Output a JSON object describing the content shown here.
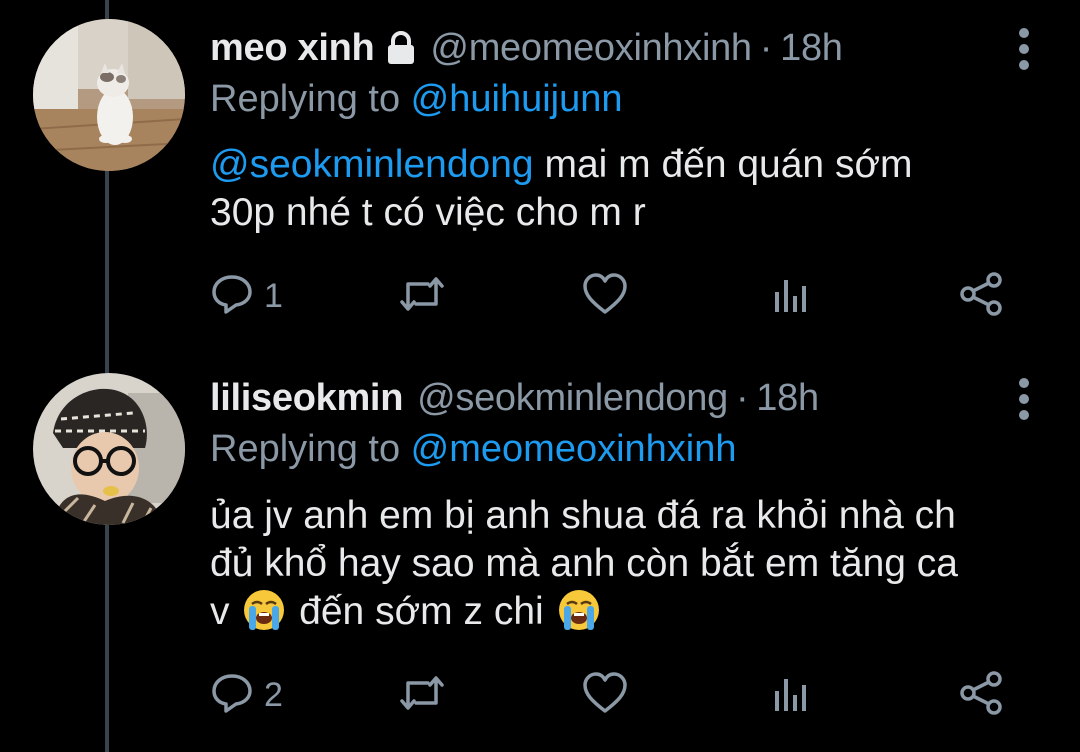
{
  "tweets": [
    {
      "display_name": "meo xinh",
      "handle": "@meomeoxinhxinh",
      "separator": "·",
      "time": "18h",
      "replying_prefix": "Replying to ",
      "replying_to": "@huihuijunn",
      "body": {
        "mention": "@seokminlendong",
        "line1_rest": " mai m đến quán sớm",
        "line2": "30p nhé t có việc cho m r"
      },
      "reply_count": "1",
      "retweet_count": "",
      "like_count": "",
      "icons": {
        "lock": "lock-icon",
        "more": "more-vertical-icon",
        "reply": "reply-icon",
        "retweet": "retweet-icon",
        "like": "heart-icon",
        "stats": "analytics-icon",
        "share": "share-icon"
      }
    },
    {
      "display_name": "liliseokmin",
      "handle": "@seokminlendong",
      "separator": "·",
      "time": "18h",
      "replying_prefix": "Replying to ",
      "replying_to": "@meomeoxinhxinh",
      "body": {
        "line1": "ủa jv anh em bị anh shua đá ra khỏi nhà ch",
        "line2": "đủ khổ hay sao mà anh còn bắt em tăng ca",
        "line3_a": "v ",
        "line3_b": " đến sớm z chi ",
        "emoji": "loudly-crying-face-emoji"
      },
      "reply_count": "2",
      "retweet_count": "",
      "like_count": "",
      "icons": {
        "more": "more-vertical-icon",
        "reply": "reply-icon",
        "retweet": "retweet-icon",
        "like": "heart-icon",
        "stats": "analytics-icon",
        "share": "share-icon"
      }
    }
  ],
  "colors": {
    "background": "#000000",
    "text": "#e7e9ea",
    "secondary": "#8b98a5",
    "accent": "#1d9bf0",
    "thread_line": "#38444d"
  }
}
